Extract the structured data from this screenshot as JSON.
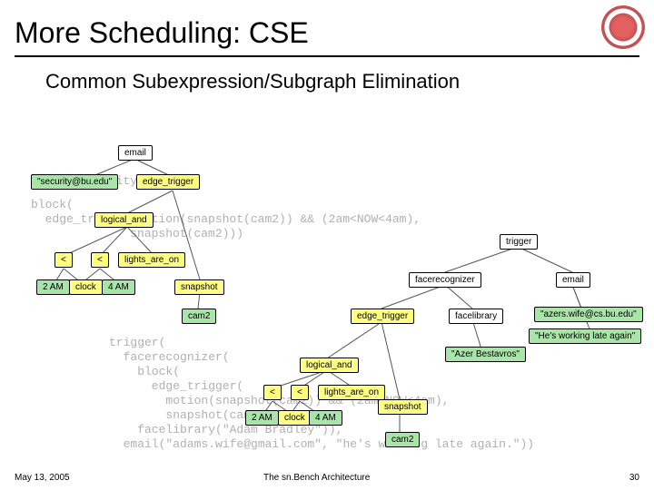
{
  "title": "More Scheduling: CSE",
  "subtitle": "Common Subexpression/Subgraph Elimination",
  "codeA": {
    "l1": "email(\"security@bu.edu\",",
    "l2": "block(",
    "l3": "  edge_trigger(motion(snapshot(cam2)) && (2am<NOW<4am),",
    "l4": "              snapshot(cam2)))"
  },
  "codeB": {
    "l1": "trigger(",
    "l2": "  facerecognizer(",
    "l3": "    block(",
    "l4": "      edge_trigger(",
    "l5": "        motion(snapshot(cam2)) && (2am<NOW<4am),",
    "l6": "        snapshot(cam2))),",
    "l7": "    facelibrary(\"Adam Bradley\")),",
    "l8": "  email(\"adams.wife@gmail.com\", \"he's working late again.\"))"
  },
  "nodesA": {
    "email": "email",
    "sec": "\"security@bu.edu\"",
    "edge": "edge_trigger",
    "land": "logical_and",
    "lt1": "<",
    "lt2": "<",
    "lights": "lights_are_on",
    "t2am": "2 AM",
    "clock": "clock",
    "t4am": "4 AM",
    "snap": "snapshot",
    "cam2": "cam2"
  },
  "nodesB": {
    "trigger": "trigger",
    "facerec": "facerecognizer",
    "email": "email",
    "edge": "edge_trigger",
    "facelib": "facelibrary",
    "wife": "\"azers.wife@cs.bu.edu\"",
    "msg": "\"He's working late again\"",
    "azer": "\"Azer Bestavros\"",
    "land": "logical_and",
    "lt1": "<",
    "lt2": "<",
    "lights": "lights_are_on",
    "t2am": "2 AM",
    "clock": "clock",
    "t4am": "4 AM",
    "snap": "snapshot",
    "cam2": "cam2"
  },
  "footer": {
    "date": "May 13, 2005",
    "mid": "The sn.Bench Architecture",
    "page": "30"
  }
}
